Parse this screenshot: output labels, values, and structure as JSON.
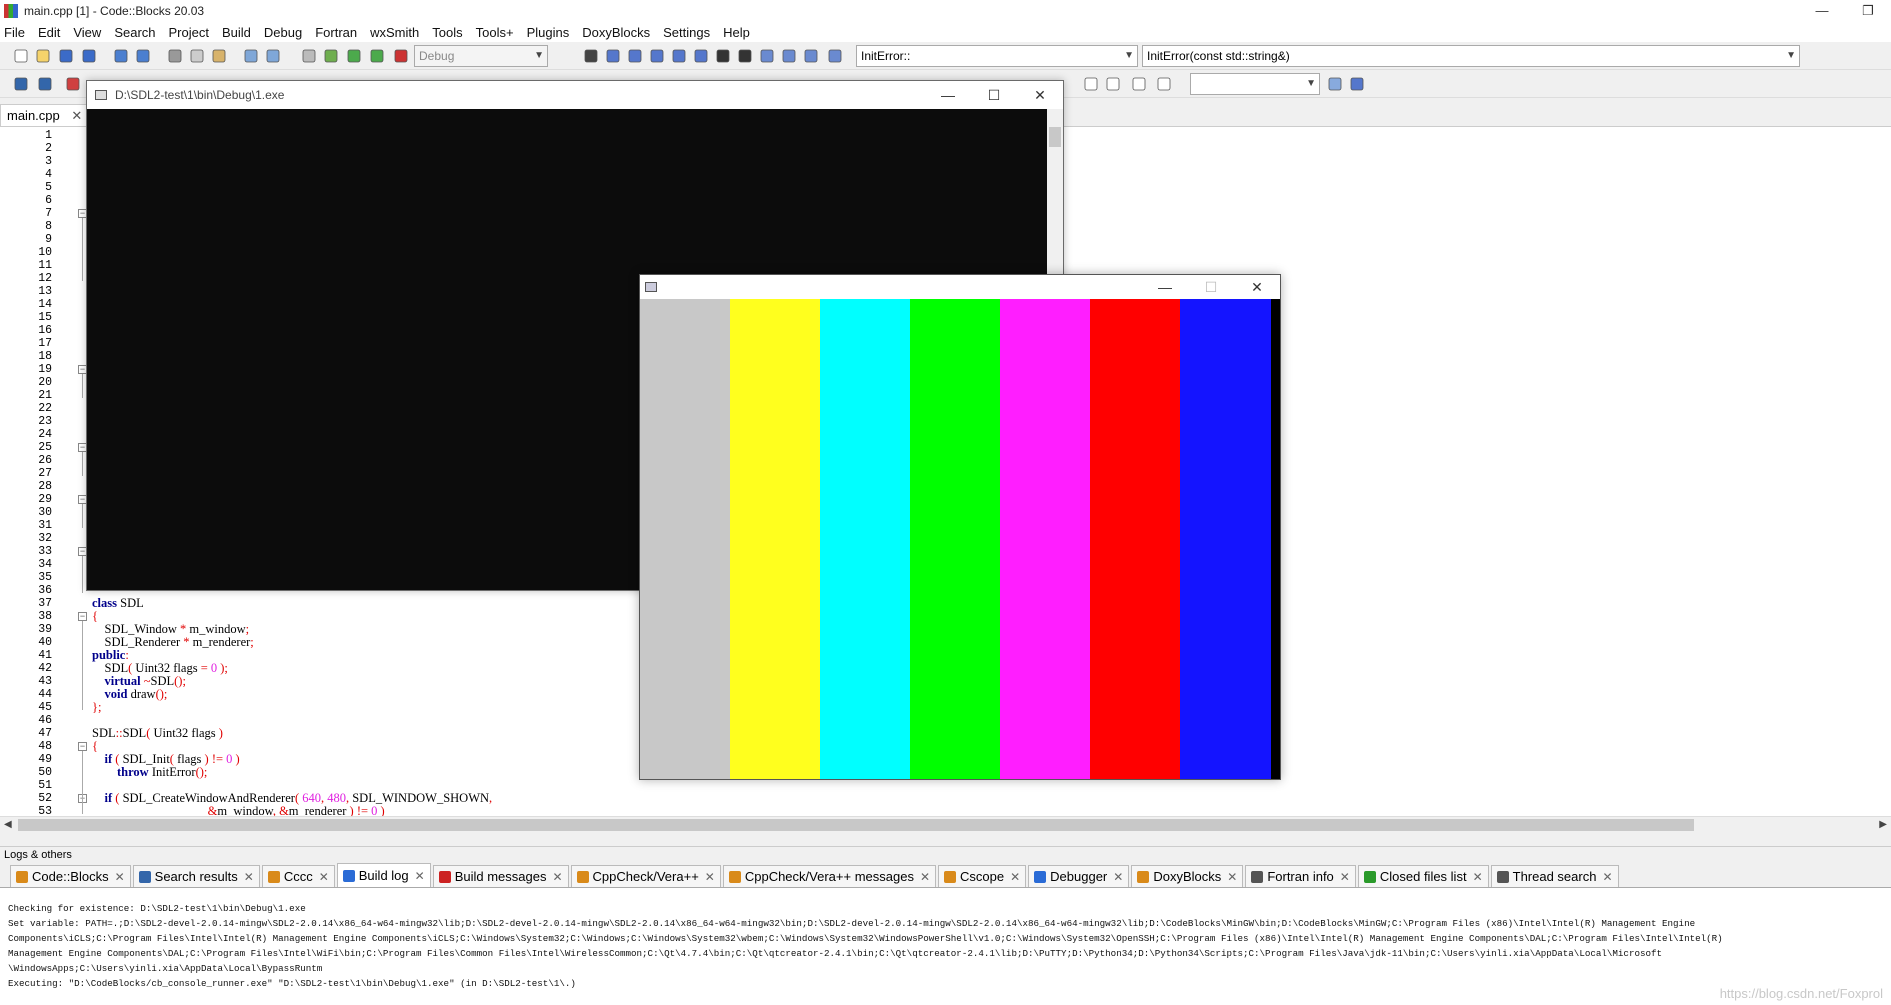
{
  "window": {
    "title": "main.cpp [1] - Code::Blocks 20.03",
    "controls": [
      "—",
      "❐"
    ]
  },
  "menu": [
    "File",
    "Edit",
    "View",
    "Search",
    "Project",
    "Build",
    "Debug",
    "Fortran",
    "wxSmith",
    "Tools",
    "Tools+",
    "Plugins",
    "DoxyBlocks",
    "Settings",
    "Help"
  ],
  "toolbar": {
    "build_target": "Debug",
    "scope_combo": "InitError::",
    "function_combo": "InitError(const std::string&)",
    "search_combo": ""
  },
  "editor": {
    "tab_label": "main.cpp",
    "tab_close": "✕",
    "line_numbers": [
      "1",
      "2",
      "3",
      "4",
      "5",
      "6",
      "7",
      "8",
      "9",
      "10",
      "11",
      "12",
      "13",
      "14",
      "15",
      "16",
      "17",
      "18",
      "19",
      "20",
      "21",
      "22",
      "23",
      "24",
      "25",
      "26",
      "27",
      "28",
      "29",
      "30",
      "31",
      "32",
      "33",
      "34",
      "35",
      "36",
      "37",
      "38",
      "39",
      "40",
      "41",
      "42",
      "43",
      "44",
      "45",
      "46",
      "47",
      "48",
      "49",
      "50",
      "51",
      "52",
      "53"
    ],
    "code": [
      {
        "line": 37,
        "tokens": [
          {
            "t": "class",
            "c": "kw"
          },
          {
            "t": " SDL",
            "c": ""
          }
        ]
      },
      {
        "line": 38,
        "tokens": [
          {
            "t": "{",
            "c": "op"
          }
        ]
      },
      {
        "line": 39,
        "tokens": [
          {
            "t": "    SDL_Window ",
            "c": ""
          },
          {
            "t": "*",
            "c": "op"
          },
          {
            "t": " m_window",
            "c": ""
          },
          {
            "t": ";",
            "c": "op"
          }
        ]
      },
      {
        "line": 40,
        "tokens": [
          {
            "t": "    SDL_Renderer ",
            "c": ""
          },
          {
            "t": "*",
            "c": "op"
          },
          {
            "t": " m_renderer",
            "c": ""
          },
          {
            "t": ";",
            "c": "op"
          }
        ]
      },
      {
        "line": 41,
        "tokens": [
          {
            "t": "public",
            "c": "kw"
          },
          {
            "t": ":",
            "c": "op"
          }
        ]
      },
      {
        "line": 42,
        "tokens": [
          {
            "t": "    SDL",
            "c": ""
          },
          {
            "t": "(",
            "c": "op"
          },
          {
            "t": " Uint32 flags ",
            "c": ""
          },
          {
            "t": "=",
            "c": "op"
          },
          {
            "t": " 0 ",
            "c": "num"
          },
          {
            "t": ");",
            "c": "op"
          }
        ]
      },
      {
        "line": 43,
        "tokens": [
          {
            "t": "    ",
            "c": ""
          },
          {
            "t": "virtual",
            "c": "kw"
          },
          {
            "t": " ",
            "c": ""
          },
          {
            "t": "~",
            "c": "op"
          },
          {
            "t": "SDL",
            "c": ""
          },
          {
            "t": "();",
            "c": "op"
          }
        ]
      },
      {
        "line": 44,
        "tokens": [
          {
            "t": "    ",
            "c": ""
          },
          {
            "t": "void",
            "c": "kw"
          },
          {
            "t": " draw",
            "c": ""
          },
          {
            "t": "();",
            "c": "op"
          }
        ]
      },
      {
        "line": 45,
        "tokens": [
          {
            "t": "};",
            "c": "op"
          }
        ]
      },
      {
        "line": 47,
        "tokens": [
          {
            "t": "SDL",
            "c": ""
          },
          {
            "t": "::",
            "c": "op"
          },
          {
            "t": "SDL",
            "c": ""
          },
          {
            "t": "(",
            "c": "op"
          },
          {
            "t": " Uint32 flags ",
            "c": ""
          },
          {
            "t": ")",
            "c": "op"
          }
        ]
      },
      {
        "line": 48,
        "tokens": [
          {
            "t": "{",
            "c": "op"
          }
        ]
      },
      {
        "line": 49,
        "tokens": [
          {
            "t": "    ",
            "c": ""
          },
          {
            "t": "if",
            "c": "kw"
          },
          {
            "t": " ",
            "c": ""
          },
          {
            "t": "(",
            "c": "op"
          },
          {
            "t": " SDL_Init",
            "c": ""
          },
          {
            "t": "(",
            "c": "op"
          },
          {
            "t": " flags ",
            "c": ""
          },
          {
            "t": ")",
            "c": "op"
          },
          {
            "t": " ",
            "c": ""
          },
          {
            "t": "!=",
            "c": "op"
          },
          {
            "t": " 0 ",
            "c": "num"
          },
          {
            "t": ")",
            "c": "op"
          }
        ]
      },
      {
        "line": 50,
        "tokens": [
          {
            "t": "        ",
            "c": ""
          },
          {
            "t": "throw",
            "c": "kw"
          },
          {
            "t": " InitError",
            "c": ""
          },
          {
            "t": "();",
            "c": "op"
          }
        ]
      },
      {
        "line": 52,
        "tokens": [
          {
            "t": "    ",
            "c": ""
          },
          {
            "t": "if",
            "c": "kw"
          },
          {
            "t": " ",
            "c": ""
          },
          {
            "t": "(",
            "c": "op"
          },
          {
            "t": " SDL_CreateWindowAndRenderer",
            "c": ""
          },
          {
            "t": "(",
            "c": "op"
          },
          {
            "t": " 640",
            "c": "num"
          },
          {
            "t": ",",
            "c": "op"
          },
          {
            "t": " 480",
            "c": "num"
          },
          {
            "t": ",",
            "c": "op"
          },
          {
            "t": " SDL_WINDOW_SHOWN",
            "c": ""
          },
          {
            "t": ",",
            "c": "op"
          }
        ]
      },
      {
        "line": 53,
        "tokens": [
          {
            "t": "                                     ",
            "c": ""
          },
          {
            "t": "&",
            "c": "op"
          },
          {
            "t": "m_window",
            "c": ""
          },
          {
            "t": ",",
            "c": "op"
          },
          {
            "t": " ",
            "c": ""
          },
          {
            "t": "&",
            "c": "op"
          },
          {
            "t": "m_renderer ",
            "c": ""
          },
          {
            "t": ")",
            "c": "op"
          },
          {
            "t": " ",
            "c": ""
          },
          {
            "t": "!=",
            "c": "op"
          },
          {
            "t": " 0 ",
            "c": "num"
          },
          {
            "t": ")",
            "c": "op"
          }
        ]
      }
    ]
  },
  "console_window": {
    "title": "D:\\SDL2-test\\1\\bin\\Debug\\1.exe",
    "controls": [
      "—",
      "☐",
      "✕"
    ]
  },
  "sdl_window": {
    "controls": [
      "—",
      "☐",
      "✕"
    ],
    "color_bars": [
      "#c8c8c8",
      "#ffff1e",
      "#00ffff",
      "#00ff00",
      "#ff1eff",
      "#ff0000",
      "#1414ff",
      "#000000"
    ]
  },
  "logs": {
    "label": "Logs & others",
    "tabs": [
      {
        "label": "Code::Blocks",
        "icon": "document-icon",
        "color": "#d98a1a"
      },
      {
        "label": "Search results",
        "icon": "search-icon",
        "color": "#3366aa"
      },
      {
        "label": "Cccc",
        "icon": "document-icon",
        "color": "#d98a1a"
      },
      {
        "label": "Build log",
        "icon": "gear-icon",
        "color": "#2a6bd6",
        "active": true
      },
      {
        "label": "Build messages",
        "icon": "pin-icon",
        "color": "#cc2222"
      },
      {
        "label": "CppCheck/Vera++",
        "icon": "document-icon",
        "color": "#d98a1a"
      },
      {
        "label": "CppCheck/Vera++ messages",
        "icon": "document-icon",
        "color": "#d98a1a"
      },
      {
        "label": "Cscope",
        "icon": "document-icon",
        "color": "#d98a1a"
      },
      {
        "label": "Debugger",
        "icon": "gear-icon",
        "color": "#2a6bd6"
      },
      {
        "label": "DoxyBlocks",
        "icon": "document-icon",
        "color": "#d98a1a"
      },
      {
        "label": "Fortran info",
        "icon": "fortran-icon",
        "color": "#555555"
      },
      {
        "label": "Closed files list",
        "icon": "refresh-icon",
        "color": "#2a9a2a"
      },
      {
        "label": "Thread search",
        "icon": "search-icon",
        "color": "#555555"
      }
    ],
    "lines": [
      "Checking for existence: D:\\SDL2-test\\1\\bin\\Debug\\1.exe",
      "Set variable: PATH=.;D:\\SDL2-devel-2.0.14-mingw\\SDL2-2.0.14\\x86_64-w64-mingw32\\lib;D:\\SDL2-devel-2.0.14-mingw\\SDL2-2.0.14\\x86_64-w64-mingw32\\bin;D:\\SDL2-devel-2.0.14-mingw\\SDL2-2.0.14\\x86_64-w64-mingw32\\lib;D:\\CodeBlocks\\MinGW\\bin;D:\\CodeBlocks\\MinGW;C:\\Program Files (x86)\\Intel\\Intel(R) Management Engine",
      "Components\\iCLS;C:\\Program Files\\Intel\\Intel(R) Management Engine Components\\iCLS;C:\\Windows\\System32;C:\\Windows;C:\\Windows\\System32\\wbem;C:\\Windows\\System32\\WindowsPowerShell\\v1.0;C:\\Windows\\System32\\OpenSSH;C:\\Program Files (x86)\\Intel\\Intel(R) Management Engine Components\\DAL;C:\\Program Files\\Intel\\Intel(R)",
      "Management Engine Components\\DAL;C:\\Program Files\\Intel\\WiFi\\bin;C:\\Program Files\\Common Files\\Intel\\WirelessCommon;C:\\Qt\\4.7.4\\bin;C:\\Qt\\qtcreator-2.4.1\\bin;C:\\Qt\\qtcreator-2.4.1\\lib;D:\\PuTTY;D:\\Python34;D:\\Python34\\Scripts;C:\\Program Files\\Java\\jdk-11\\bin;C:\\Users\\yinli.xia\\AppData\\Local\\Microsoft",
      "\\WindowsApps;C:\\Users\\yinli.xia\\AppData\\Local\\BypassRuntm",
      "Executing: \"D:\\CodeBlocks/cb_console_runner.exe\" \"D:\\SDL2-test\\1\\bin\\Debug\\1.exe\"  (in D:\\SDL2-test\\1\\.)"
    ],
    "close_symbol": "✕"
  },
  "watermark": "https://blog.csdn.net/Foxprol"
}
